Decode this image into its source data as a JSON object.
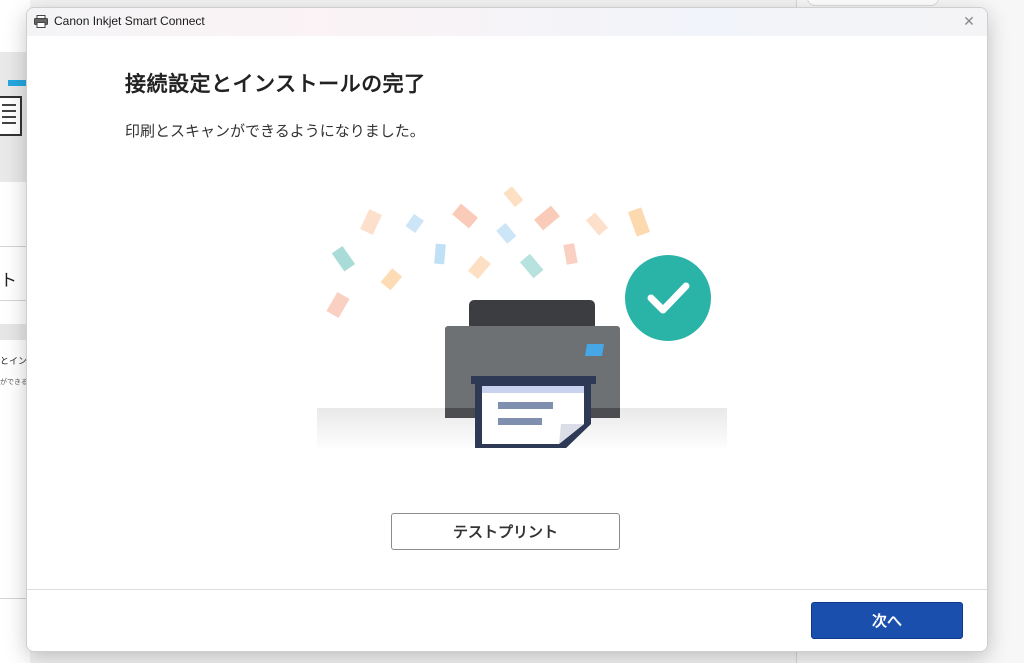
{
  "window": {
    "title": "Canon Inkjet Smart Connect",
    "close_glyph": "✕"
  },
  "main": {
    "heading": "接続設定とインストールの完了",
    "message": "印刷とスキャンができるようになりました。"
  },
  "buttons": {
    "test_print_label": "テストプリント",
    "next_label": "次へ"
  },
  "background_app": {
    "fragments": [
      "ト",
      "とインス",
      "ができる"
    ]
  },
  "colors": {
    "accent_blue": "#1a4fae",
    "check_teal": "#2ab4a8",
    "printer_gray": "#6e7174",
    "printer_dark": "#3c3d40",
    "paper_navy": "#2e3a55"
  },
  "icons": {
    "app": "printer-icon",
    "close": "close-icon",
    "success": "checkmark-icon"
  }
}
